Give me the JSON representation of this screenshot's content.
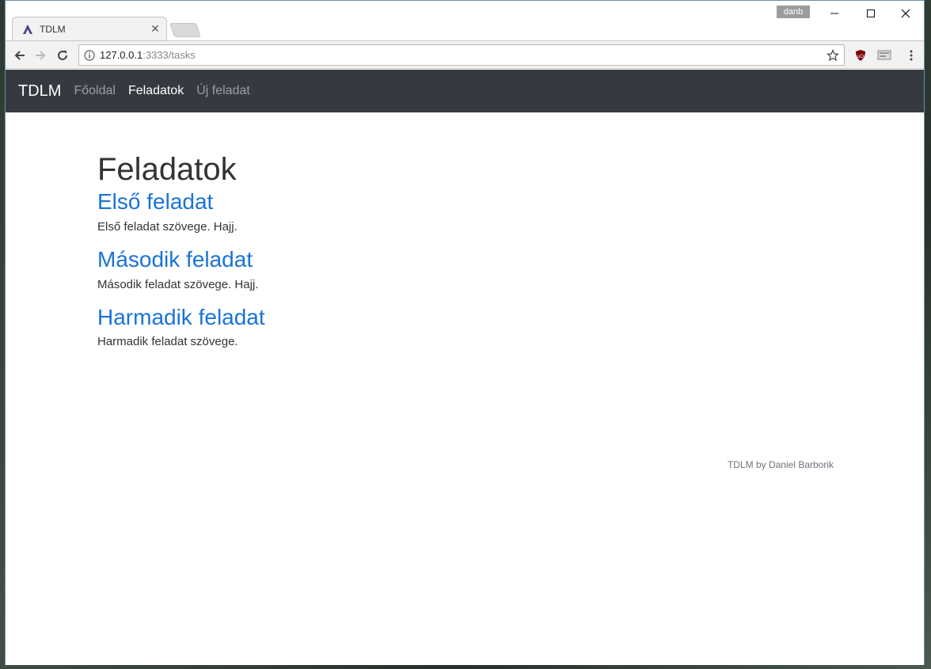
{
  "browser": {
    "tab_title": "TDLM",
    "profile_name": "danb",
    "url_host": "127.0.0.1",
    "url_rest": ":3333/tasks"
  },
  "navbar": {
    "brand": "TDLM",
    "links": [
      {
        "label": "Főoldal",
        "active": false
      },
      {
        "label": "Feladatok",
        "active": true
      },
      {
        "label": "Új feladat",
        "active": false
      }
    ]
  },
  "main": {
    "title": "Feladatok",
    "tasks": [
      {
        "title": "Első feladat",
        "text": "Első feladat szövege. Hajj."
      },
      {
        "title": "Második feladat",
        "text": "Második feladat szövege. Hajj."
      },
      {
        "title": "Harmadik feladat",
        "text": "Harmadik feladat szövege."
      }
    ]
  },
  "footer": {
    "text": "TDLM by Daniel Barborik"
  },
  "colors": {
    "navbar_bg": "#343a40",
    "link": "#1a73d8"
  }
}
